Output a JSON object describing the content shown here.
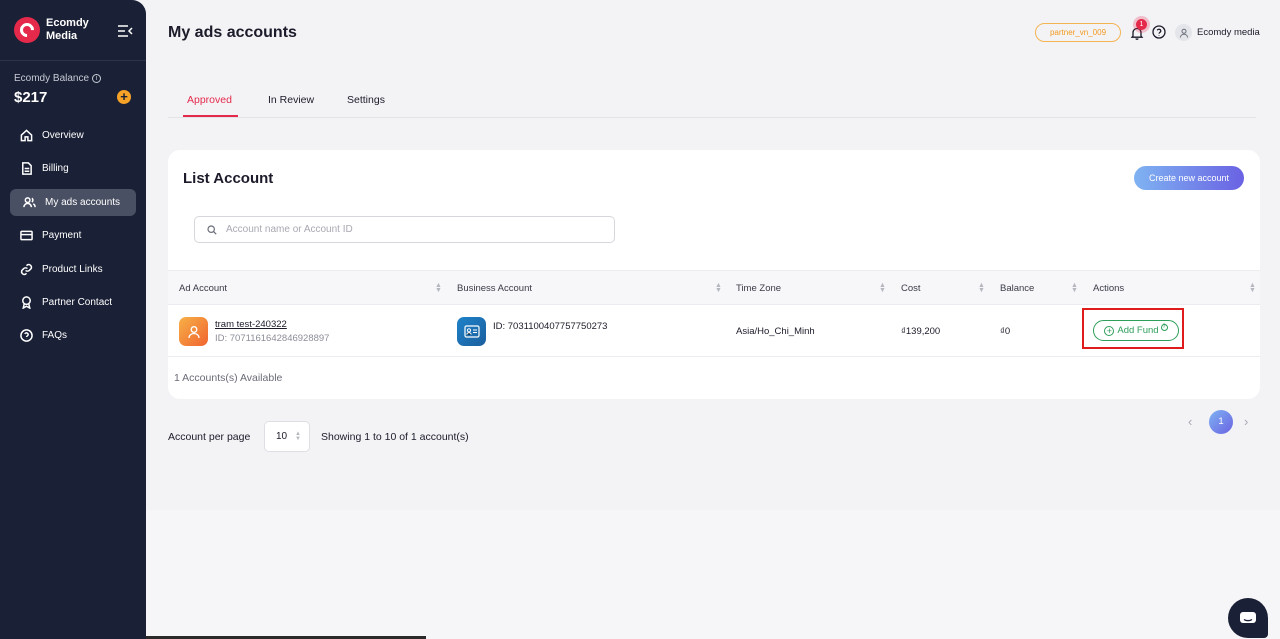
{
  "sidebar": {
    "brand": "Ecomdy Media",
    "balance_label": "Ecomdy Balance",
    "balance_value": "$217",
    "items": [
      {
        "label": "Overview",
        "icon": "home-icon"
      },
      {
        "label": "Billing",
        "icon": "document-icon"
      },
      {
        "label": "My ads accounts",
        "icon": "users-icon",
        "active": true
      },
      {
        "label": "Payment",
        "icon": "card-icon"
      },
      {
        "label": "Product Links",
        "icon": "link-icon"
      },
      {
        "label": "Partner Contact",
        "icon": "award-icon"
      },
      {
        "label": "FAQs",
        "icon": "help-circle-icon"
      }
    ]
  },
  "header": {
    "title": "My ads accounts",
    "partner_badge": "partner_vn_009",
    "notification_count": "1",
    "user_name": "Ecomdy media"
  },
  "tabs": [
    {
      "label": "Approved",
      "active": true
    },
    {
      "label": "In Review"
    },
    {
      "label": "Settings"
    }
  ],
  "list": {
    "title": "List Account",
    "create_button": "Create new account",
    "search_placeholder": "Account name or Account ID",
    "columns": [
      "Ad Account",
      "Business Account",
      "Time Zone",
      "Cost",
      "Balance",
      "Actions"
    ],
    "rows": [
      {
        "ad_account_name": "tram test-240322",
        "ad_account_id": "ID: 7071161642846928897",
        "business_account_id": "ID: 7031100407757750273",
        "time_zone": "Asia/Ho_Chi_Minh",
        "cost": "₫139,200",
        "balance": "₫0",
        "action_label": "Add Fund"
      }
    ],
    "accounts_available": "1 Accounts(s) Available"
  },
  "pagination": {
    "per_page_label": "Account per page",
    "per_page_value": "10",
    "showing": "Showing 1 to 10 of 1 account(s)",
    "current_page": "1"
  },
  "colors": {
    "sidebar_bg": "#1a2035",
    "accent": "#e5294b",
    "add_fund": "#2e9e5a",
    "balance_add": "#f6a226"
  }
}
